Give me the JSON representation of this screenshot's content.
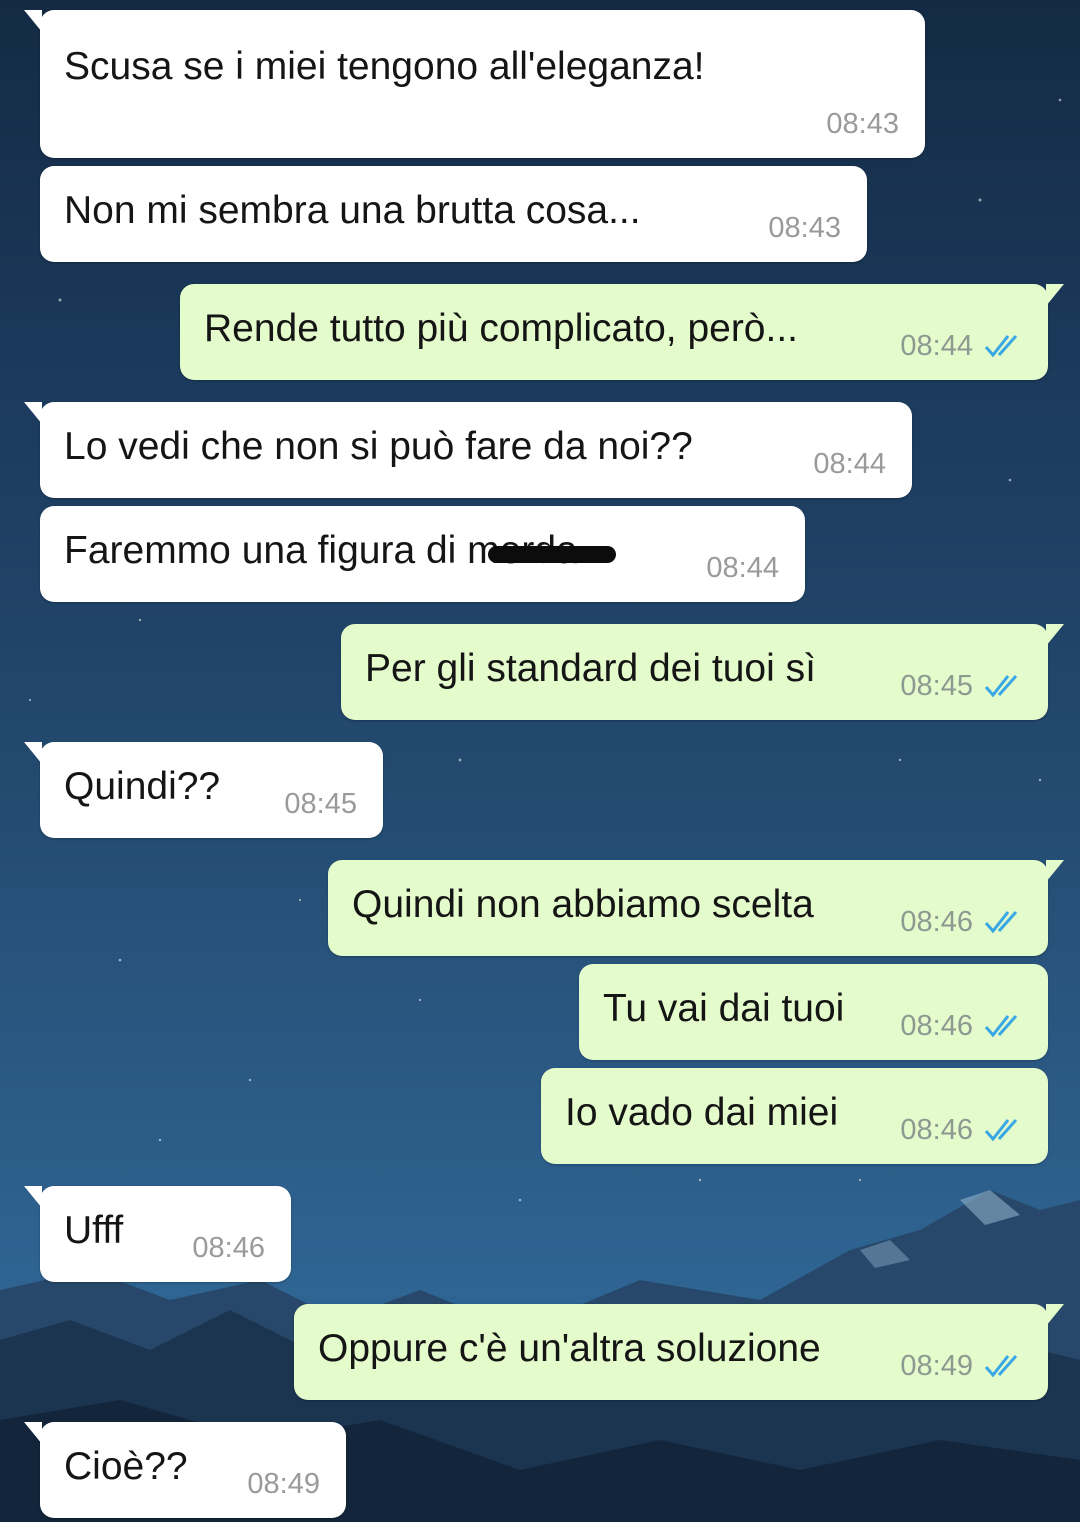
{
  "colors": {
    "incoming_bubble": "#ffffff",
    "outgoing_bubble": "#e4fbcb",
    "read_ticks": "#39a7e6",
    "timestamp": "#9a9a9a"
  },
  "messages": [
    {
      "text": "Scusa se i miei tengono all'eleganza!",
      "time": "08:43",
      "direction": "incoming"
    },
    {
      "text": "Non mi sembra una brutta cosa...",
      "time": "08:43",
      "direction": "incoming"
    },
    {
      "text": "Rende tutto più complicato, però...",
      "time": "08:44",
      "direction": "outgoing",
      "status": "read"
    },
    {
      "text": "Lo vedi che non si può fare da noi??",
      "time": "08:44",
      "direction": "incoming"
    },
    {
      "text": "Faremmo una figura di merda.",
      "time": "08:44",
      "direction": "incoming",
      "censored_word": "merda"
    },
    {
      "text": "Per gli standard dei tuoi sì",
      "time": "08:45",
      "direction": "outgoing",
      "status": "read"
    },
    {
      "text": "Quindi??",
      "time": "08:45",
      "direction": "incoming"
    },
    {
      "text": "Quindi non abbiamo scelta",
      "time": "08:46",
      "direction": "outgoing",
      "status": "read"
    },
    {
      "text": "Tu vai dai tuoi",
      "time": "08:46",
      "direction": "outgoing",
      "status": "read"
    },
    {
      "text": "Io vado dai miei",
      "time": "08:46",
      "direction": "outgoing",
      "status": "read"
    },
    {
      "text": "Ufff",
      "time": "08:46",
      "direction": "incoming"
    },
    {
      "text": "Oppure c'è un'altra soluzione",
      "time": "08:49",
      "direction": "outgoing",
      "status": "read"
    },
    {
      "text": "Cioè??",
      "time": "08:49",
      "direction": "incoming"
    }
  ]
}
